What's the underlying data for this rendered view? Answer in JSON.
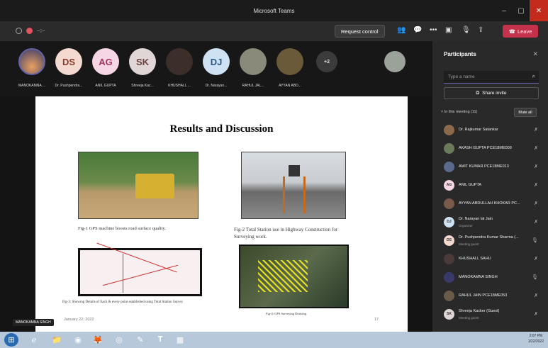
{
  "window": {
    "title": "Microsoft Teams"
  },
  "toolbar": {
    "request_control": "Request control",
    "leave": "Leave"
  },
  "participants_strip": [
    {
      "name": "MANOKAMNA ...",
      "initials": ""
    },
    {
      "name": "Dr. Pushpendra...",
      "initials": "DS"
    },
    {
      "name": "ANIL GUPTA",
      "initials": "AG"
    },
    {
      "name": "Shreeja Kac...",
      "initials": "SK"
    },
    {
      "name": "KHUSHALL ...",
      "initials": ""
    },
    {
      "name": "Dr. Narayan...",
      "initials": "DJ"
    },
    {
      "name": "RAHUL JAL...",
      "initials": ""
    },
    {
      "name": "AYYAN ABD...",
      "initials": ""
    }
  ],
  "overflow_count": "+2",
  "slide": {
    "title": "Results and Discussion",
    "fig1": "Fig-1 GPS machine boosts road surface quality.",
    "fig2": "Fig-2 Total Station use in Highway Construction for Surveying work.",
    "fig3": "Fig-3: Showing Details of Each & every point established using Total Station Survey",
    "fig4": "Fig-4: GPS Surveying Drawing.",
    "date": "January 22, 2022",
    "page": "17"
  },
  "presenter_tag": "MANOKAMNA SINGH",
  "panel": {
    "title": "Participants",
    "search_placeholder": "Type a name",
    "share_invite": "Share invite",
    "in_meeting": "In this meeting (11)",
    "mute_all": "Mute all",
    "people": [
      {
        "name": "Dr. Rajkumar Satankar",
        "sub": "",
        "initials": "",
        "color": "#8a6a4a",
        "mic": "off"
      },
      {
        "name": "AKASH GUPTA PCE18ME009",
        "sub": "",
        "initials": "",
        "color": "#6a7a5a",
        "mic": "off"
      },
      {
        "name": "AMIT KUMAR PCE18ME013",
        "sub": "",
        "initials": "",
        "color": "#5a6a8a",
        "mic": "off"
      },
      {
        "name": "ANIL GUPTA",
        "sub": "",
        "initials": "AG",
        "color": "#f6d5e5",
        "mic": "off"
      },
      {
        "name": "AYYAN ABDULLAH KHOKAR PC...",
        "sub": "",
        "initials": "",
        "color": "#7a5a4a",
        "mic": "off"
      },
      {
        "name": "Dr. Narayan lal Jain",
        "sub": "Organizer",
        "initials": "DJ",
        "color": "#cfe2f3",
        "mic": "off"
      },
      {
        "name": "Dr. Pushpendra Kumar Sharma (...",
        "sub": "Meeting guest",
        "initials": "DS",
        "color": "#f4d9d0",
        "mic": "on"
      },
      {
        "name": "KHUSHALL SAHU",
        "sub": "",
        "initials": "",
        "color": "#4a3a3a",
        "mic": "off"
      },
      {
        "name": "MANOKAMNA SINGH",
        "sub": "",
        "initials": "",
        "color": "#3a3a6a",
        "mic": "on"
      },
      {
        "name": "RAHUL JAIN PCE18ME053",
        "sub": "",
        "initials": "",
        "color": "#6a5a4a",
        "mic": "off"
      },
      {
        "name": "Shreeja Kacker (Guest)",
        "sub": "Meeting guest",
        "initials": "SK",
        "color": "#e0d6d6",
        "mic": "off"
      }
    ]
  },
  "taskbar": {
    "time": "2:07 PM",
    "date": "1/22/2022"
  }
}
